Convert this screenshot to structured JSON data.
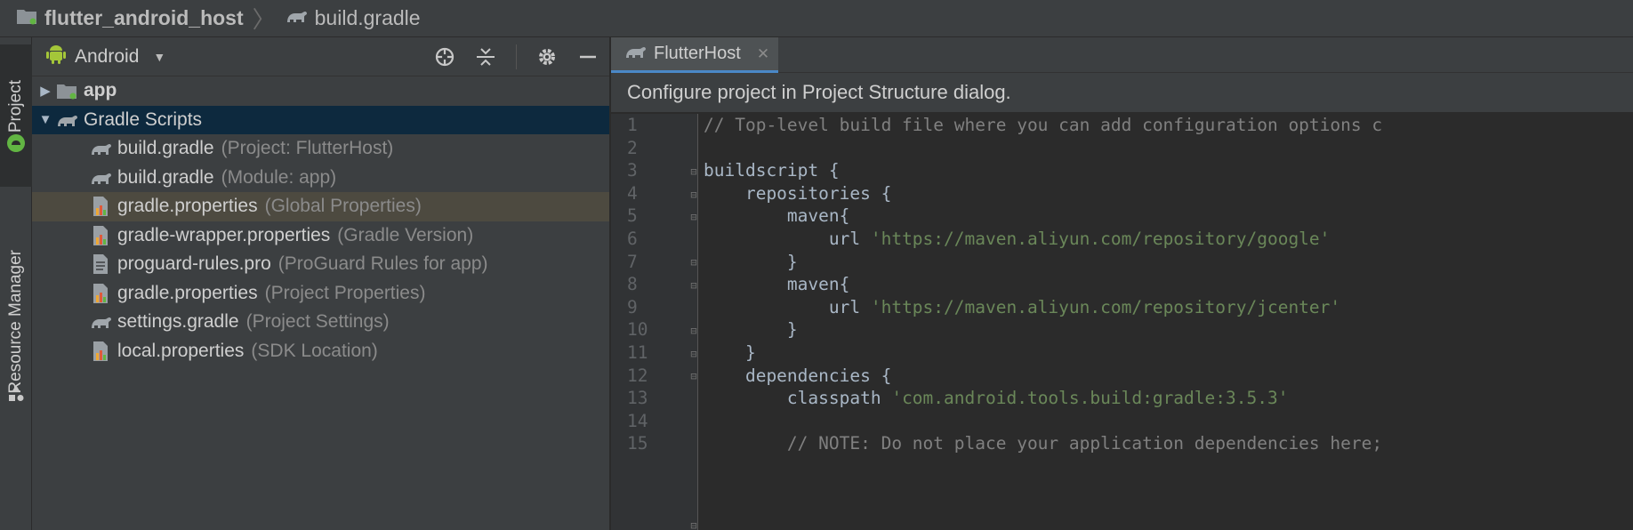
{
  "breadcrumb": {
    "project": "flutter_android_host",
    "file": "build.gradle"
  },
  "tool_strip": {
    "project_tab": "1: Project",
    "resource_tab": "Resource Manager"
  },
  "project_panel": {
    "view_mode": "Android",
    "tree": [
      {
        "label": "app",
        "hint": "",
        "kind": "module",
        "expanded": false
      },
      {
        "label": "Gradle Scripts",
        "hint": "",
        "kind": "group",
        "expanded": true,
        "selected": true
      },
      {
        "label": "build.gradle",
        "hint": "(Project: FlutterHost)",
        "kind": "gradle"
      },
      {
        "label": "build.gradle",
        "hint": "(Module: app)",
        "kind": "gradle"
      },
      {
        "label": "gradle.properties",
        "hint": "(Global Properties)",
        "kind": "properties",
        "highlighted": true
      },
      {
        "label": "gradle-wrapper.properties",
        "hint": "(Gradle Version)",
        "kind": "properties"
      },
      {
        "label": "proguard-rules.pro",
        "hint": "(ProGuard Rules for app)",
        "kind": "text"
      },
      {
        "label": "gradle.properties",
        "hint": "(Project Properties)",
        "kind": "properties"
      },
      {
        "label": "settings.gradle",
        "hint": "(Project Settings)",
        "kind": "gradle"
      },
      {
        "label": "local.properties",
        "hint": "(SDK Location)",
        "kind": "properties"
      }
    ]
  },
  "editor": {
    "tab_title": "FlutterHost",
    "banner": "Configure project in Project Structure dialog.",
    "line_numbers": [
      "1",
      "2",
      "3",
      "4",
      "5",
      "6",
      "7",
      "8",
      "9",
      "10",
      "11",
      "12",
      "13",
      "14",
      "15"
    ],
    "lines": [
      {
        "text": "// Top-level build file where you can add configuration options c",
        "type": "comment"
      },
      {
        "text": "",
        "type": "plain"
      },
      {
        "text": "buildscript {",
        "type": "plain"
      },
      {
        "text": "    repositories {",
        "type": "plain"
      },
      {
        "text": "        maven{",
        "type": "plain"
      },
      {
        "pre": "            url ",
        "str": "'https://maven.aliyun.com/repository/google'",
        "type": "mixed"
      },
      {
        "text": "        }",
        "type": "plain"
      },
      {
        "text": "        maven{",
        "type": "plain"
      },
      {
        "pre": "            url ",
        "str": "'https://maven.aliyun.com/repository/jcenter'",
        "type": "mixed"
      },
      {
        "text": "        }",
        "type": "plain"
      },
      {
        "text": "    }",
        "type": "plain"
      },
      {
        "text": "    dependencies {",
        "type": "plain"
      },
      {
        "pre": "        classpath ",
        "str": "'com.android.tools.build:gradle:3.5.3'",
        "type": "mixed"
      },
      {
        "text": "",
        "type": "plain"
      },
      {
        "text": "        // NOTE: Do not place your application dependencies here;",
        "type": "comment"
      }
    ]
  }
}
